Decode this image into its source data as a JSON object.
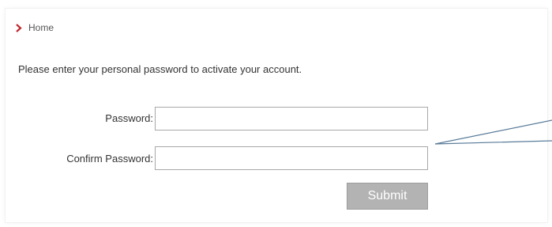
{
  "breadcrumb": {
    "label": "Home",
    "chevron_icon": "chevron-right-icon",
    "chevron_color": "#c0272d"
  },
  "intro_text": "Please enter your personal password to activate your account.",
  "form": {
    "password_label": "Password:",
    "password_value": "",
    "confirm_label": "Confirm Password:",
    "confirm_value": "",
    "submit_label": "Submit"
  },
  "colors": {
    "submit_bg": "#b3b3b3",
    "callout_line": "#5a7c9a"
  }
}
